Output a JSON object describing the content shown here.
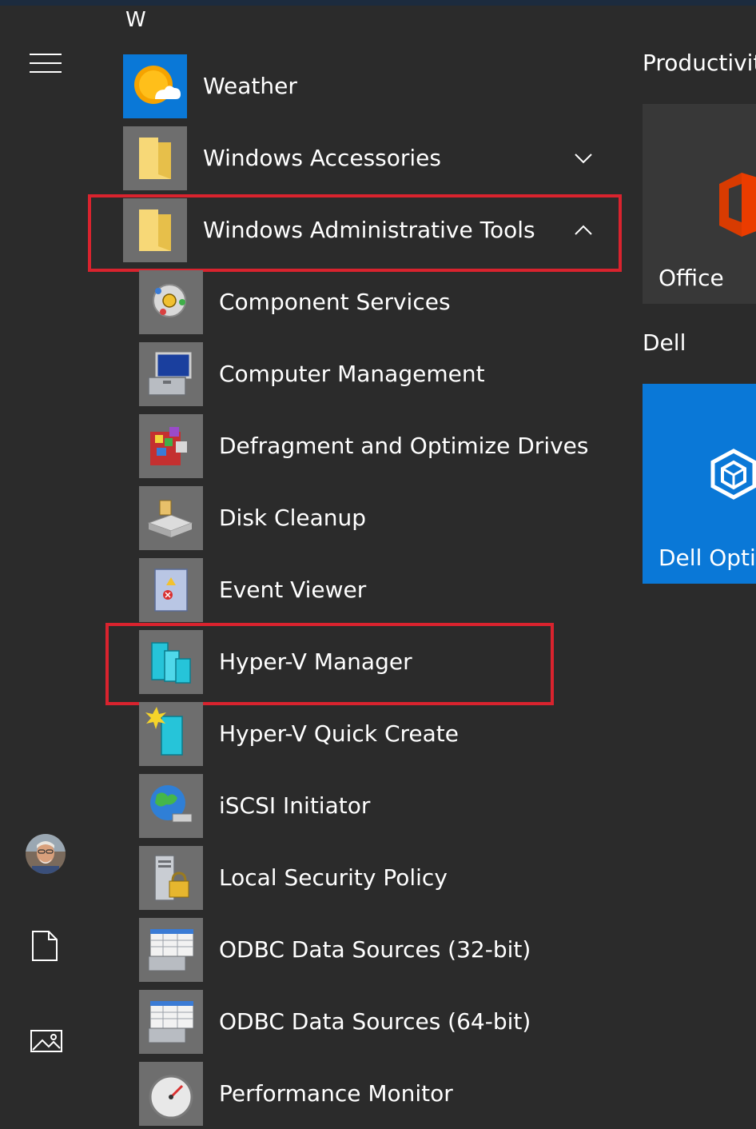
{
  "list": {
    "section_letter": "W",
    "apps": [
      {
        "label": "Weather",
        "icon": "weather-icon",
        "expandable": false
      },
      {
        "label": "Windows Accessories",
        "icon": "folder-icon",
        "expandable": true,
        "expanded": false
      },
      {
        "label": "Windows Administrative Tools",
        "icon": "folder-icon",
        "expandable": true,
        "expanded": true
      }
    ],
    "admin_tools": [
      {
        "label": "Component Services",
        "icon": "component-services-icon"
      },
      {
        "label": "Computer Management",
        "icon": "computer-management-icon"
      },
      {
        "label": "Defragment and Optimize Drives",
        "icon": "defragment-icon"
      },
      {
        "label": "Disk Cleanup",
        "icon": "disk-cleanup-icon"
      },
      {
        "label": "Event Viewer",
        "icon": "event-viewer-icon"
      },
      {
        "label": "Hyper-V Manager",
        "icon": "hyper-v-manager-icon"
      },
      {
        "label": "Hyper-V Quick Create",
        "icon": "hyper-v-quick-create-icon"
      },
      {
        "label": "iSCSI Initiator",
        "icon": "iscsi-initiator-icon"
      },
      {
        "label": "Local Security Policy",
        "icon": "local-security-policy-icon"
      },
      {
        "label": "ODBC Data Sources (32-bit)",
        "icon": "odbc-icon"
      },
      {
        "label": "ODBC Data Sources (64-bit)",
        "icon": "odbc-icon"
      },
      {
        "label": "Performance Monitor",
        "icon": "performance-monitor-icon"
      }
    ]
  },
  "tiles": {
    "groups": [
      {
        "label": "Productivit",
        "tile_label": "Office",
        "tile_icon": "office-icon"
      },
      {
        "label": "Dell",
        "tile_label": "Dell Optir",
        "tile_icon": "dell-optimizer-icon"
      }
    ]
  },
  "rail": {
    "items": [
      "hamburger-menu-icon",
      "user-avatar",
      "documents-icon",
      "pictures-icon"
    ]
  },
  "colors": {
    "background": "#2b2b2b",
    "tile_gray": "#6e6e6e",
    "highlight_red": "#d9232e",
    "dell_blue": "#0a78d7",
    "text": "#ffffff"
  }
}
